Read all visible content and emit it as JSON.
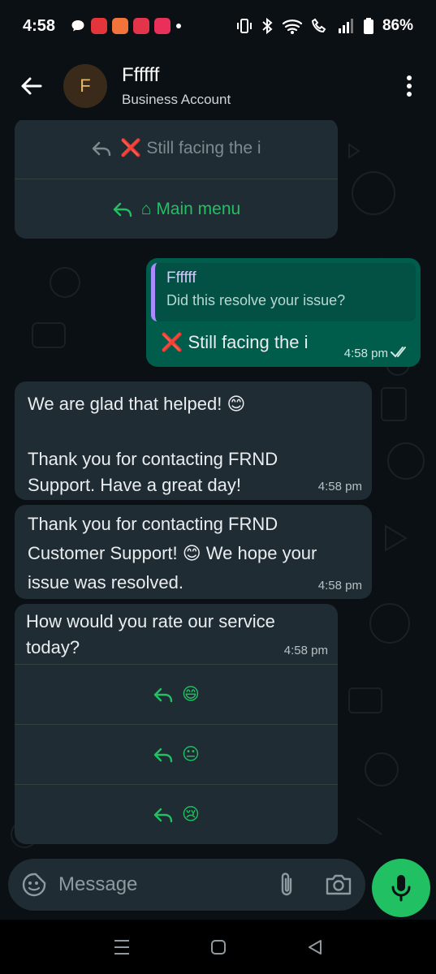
{
  "status_bar": {
    "time": "4:58",
    "battery": "86%",
    "notification_icons": [
      "chat-bubble-icon",
      "app-icon-red",
      "app-icon-orange",
      "app-icon-red-2",
      "frnd-app-icon"
    ]
  },
  "header": {
    "avatar_letter": "F",
    "name": "Ffffff",
    "subtitle": "Business Account"
  },
  "top_card": {
    "buttons": [
      {
        "label": "❌ Still facing the i",
        "dimmed": true
      },
      {
        "label": "⌂ Main menu",
        "dimmed": false
      }
    ]
  },
  "outgoing": {
    "quote_name": "Ffffff",
    "quote_text": "Did this resolve your issue?",
    "text": "❌ Still facing the i",
    "time": "4:58 pm"
  },
  "messages": [
    {
      "line1": "We are glad that helped! 😊",
      "line2": "",
      "line3": "Thank you for contacting FRND",
      "line4": "Support. Have a great day!",
      "time": "4:58 pm"
    },
    {
      "line1": "Thank you for contacting FRND",
      "line2": "Customer Support! 😊 We hope your",
      "line3": "issue was resolved.",
      "time": "4:58 pm"
    }
  ],
  "rating": {
    "line1": "How would you rate our service",
    "line2": "today?",
    "time": "4:58 pm",
    "options": [
      "😄",
      "😐",
      "😢"
    ]
  },
  "input": {
    "placeholder": "Message"
  },
  "colors": {
    "accent": "#21c063",
    "incoming_bubble": "#202c33",
    "outgoing_bubble": "#005c4b",
    "background": "#0b1014"
  }
}
